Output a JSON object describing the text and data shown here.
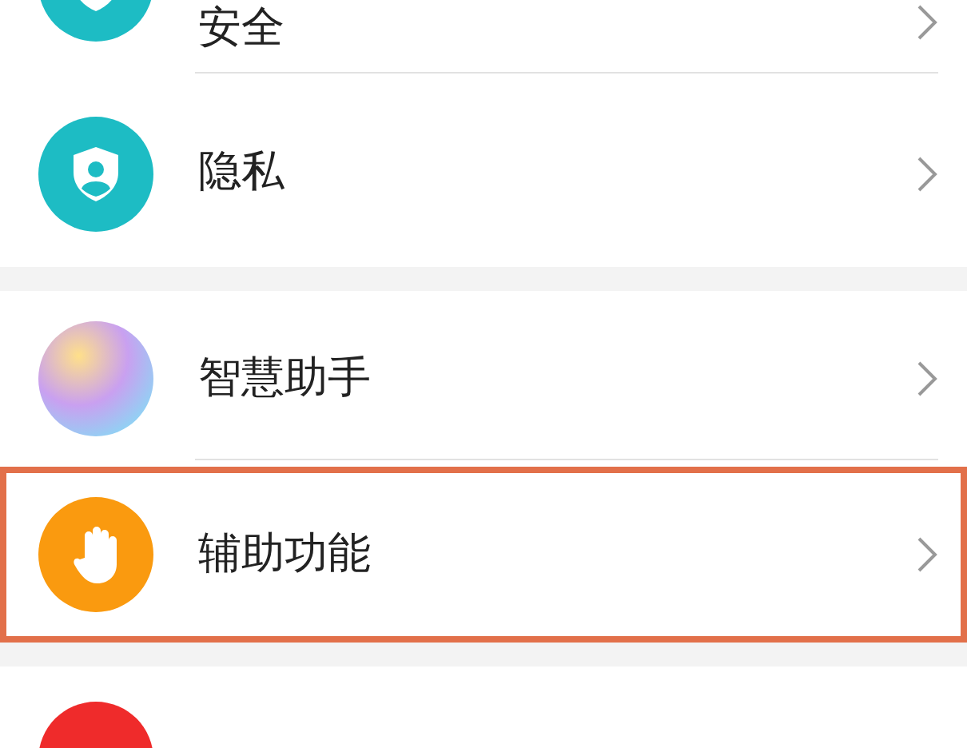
{
  "groups": [
    {
      "items": [
        {
          "kind": "security",
          "label": "安全",
          "color": "#1dbcc4",
          "highlighted": false
        },
        {
          "kind": "privacy",
          "label": "隐私",
          "color": "#1dbcc4",
          "highlighted": false
        }
      ]
    },
    {
      "items": [
        {
          "kind": "assistant",
          "label": "智慧助手",
          "color": "#c9a0f0",
          "highlighted": false
        },
        {
          "kind": "accessibility",
          "label": "辅助功能",
          "color": "#fa9a0f",
          "highlighted": true
        }
      ]
    },
    {
      "items": [
        {
          "kind": "plain",
          "color": "#ef2b2b",
          "highlighted": false
        }
      ]
    }
  ]
}
